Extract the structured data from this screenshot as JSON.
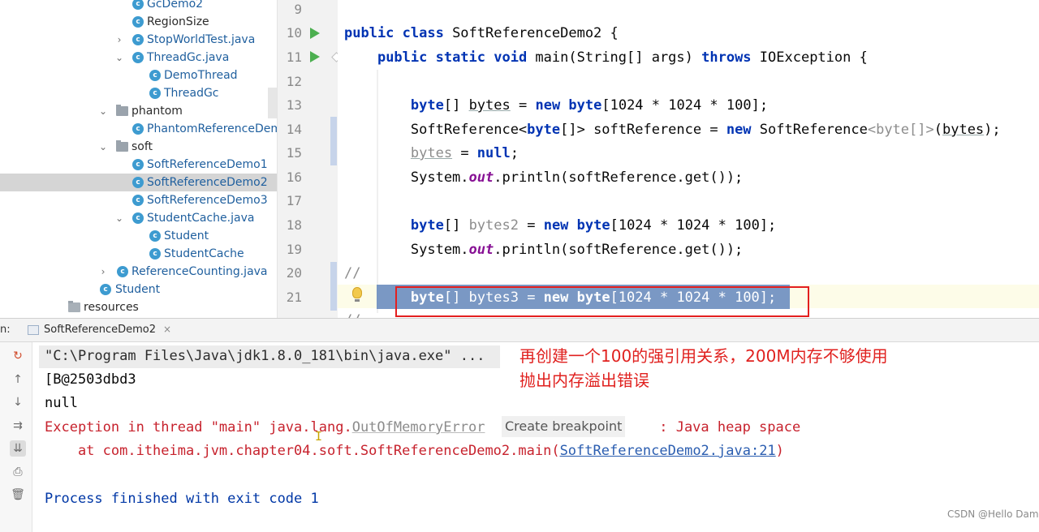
{
  "tree": {
    "items": [
      {
        "label": "GcDemo2"
      },
      {
        "label": "RegionSize"
      },
      {
        "label": "StopWorldTest.java"
      },
      {
        "label": "ThreadGc.java"
      },
      {
        "label": "DemoThread"
      },
      {
        "label": "ThreadGc"
      },
      {
        "label": "phantom"
      },
      {
        "label": "PhantomReferenceDemo"
      },
      {
        "label": "soft"
      },
      {
        "label": "SoftReferenceDemo1"
      },
      {
        "label": "SoftReferenceDemo2"
      },
      {
        "label": "SoftReferenceDemo3"
      },
      {
        "label": "StudentCache.java"
      },
      {
        "label": "Student"
      },
      {
        "label": "StudentCache"
      },
      {
        "label": "ReferenceCounting.java"
      },
      {
        "label": "Student"
      },
      {
        "label": "resources"
      }
    ],
    "class_icon_letter": "c",
    "selected": "SoftReferenceDemo2"
  },
  "editor": {
    "line_numbers": [
      "9",
      "10",
      "11",
      "12",
      "13",
      "14",
      "15",
      "16",
      "17",
      "18",
      "19",
      "20",
      "21"
    ],
    "current_line": "21"
  },
  "run": {
    "label": "n:",
    "tab_title": "SoftReferenceDemo2",
    "tab_close": "×",
    "output": {
      "command": "\"C:\\Program Files\\Java\\jdk1.8.0_181\\bin\\java.exe\" ...",
      "line2": "[B@2503dbd3",
      "line3": "null",
      "exception_prefix": "Exception in thread \"main\" java.lang.",
      "exception_class": "OutOfMemoryError",
      "create_breakpoint": "Create breakpoint",
      "exception_suffix": " : Java heap space",
      "stack_prefix": "    at com.itheima.jvm.chapter04.soft.SoftReferenceDemo2.main(",
      "stack_link": "SoftReferenceDemo2.java:21",
      "stack_suffix": ")",
      "finish": "Process finished with exit code 1"
    },
    "annotation": "再创建一个100的强引用关系，200M内存不够使用\n抛出内存溢出错误",
    "watermark": "CSDN @Hello Dam"
  },
  "colors": {
    "keyword": "#0033b3",
    "annotation_red": "#e0211f",
    "selection": "#6f8fc0",
    "run_arrow": "#4caf50"
  }
}
